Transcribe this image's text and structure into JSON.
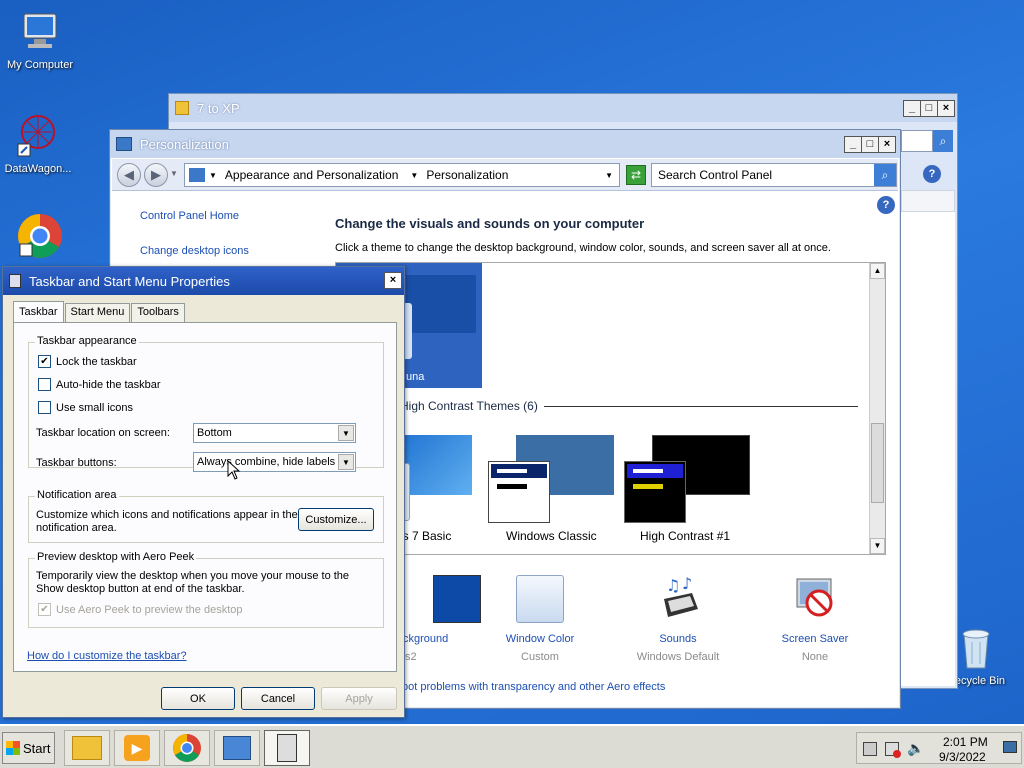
{
  "desktop": {
    "icons": [
      {
        "label": "My Computer"
      },
      {
        "label": "DataWagon..."
      },
      {
        "label": ""
      },
      {
        "label": "Recycle Bin"
      }
    ]
  },
  "window_7toxp": {
    "title": "7 to XP"
  },
  "personalization": {
    "title": "Personalization",
    "breadcrumb": [
      "Appearance and Personalization",
      "Personalization"
    ],
    "search_placeholder": "Search Control Panel",
    "sidebar": [
      "Control Panel Home",
      "Change desktop icons"
    ],
    "heading": "Change the visuals and sounds on your computer",
    "subheading": "Click a theme to change the desktop background, window color, sounds, and screen saver all at once.",
    "themes_top": {
      "name": "una"
    },
    "section_label": "High Contrast Themes (6)",
    "themes": [
      {
        "name": "ws 7 Basic"
      },
      {
        "name": "Windows Classic"
      },
      {
        "name": "High Contrast #1"
      }
    ],
    "bottom_items": [
      {
        "label": "ckground",
        "sub": "s2"
      },
      {
        "label": "Window Color",
        "sub": "Custom"
      },
      {
        "label": "Sounds",
        "sub": "Windows Default"
      },
      {
        "label": "Screen Saver",
        "sub": "None"
      }
    ],
    "troubleshoot": "oot problems with transparency and other Aero effects"
  },
  "dialog": {
    "title": "Taskbar and Start Menu Properties",
    "tabs": [
      "Taskbar",
      "Start Menu",
      "Toolbars"
    ],
    "appearance_group": "Taskbar appearance",
    "lock": {
      "label": "Lock the taskbar",
      "checked": true
    },
    "autohide": {
      "label": "Auto-hide the taskbar",
      "checked": false
    },
    "smallicons": {
      "label": "Use small icons",
      "checked": false
    },
    "location_label": "Taskbar location on screen:",
    "location_value": "Bottom",
    "buttons_label": "Taskbar buttons:",
    "buttons_value": "Always combine, hide labels",
    "notif_group": "Notification area",
    "notif_text": "Customize which icons and notifications appear in the notification area.",
    "customize_btn": "Customize...",
    "peek_group": "Preview desktop with Aero Peek",
    "peek_text": "Temporarily view the desktop when you move your mouse to the Show desktop button at end of the taskbar.",
    "peek_cb": {
      "label": "Use Aero Peek to preview the desktop",
      "checked": true
    },
    "help_link": "How do I customize the taskbar?",
    "ok": "OK",
    "cancel": "Cancel",
    "apply": "Apply"
  },
  "taskbar": {
    "start": "Start",
    "time": "2:01 PM",
    "date": "9/3/2022"
  }
}
